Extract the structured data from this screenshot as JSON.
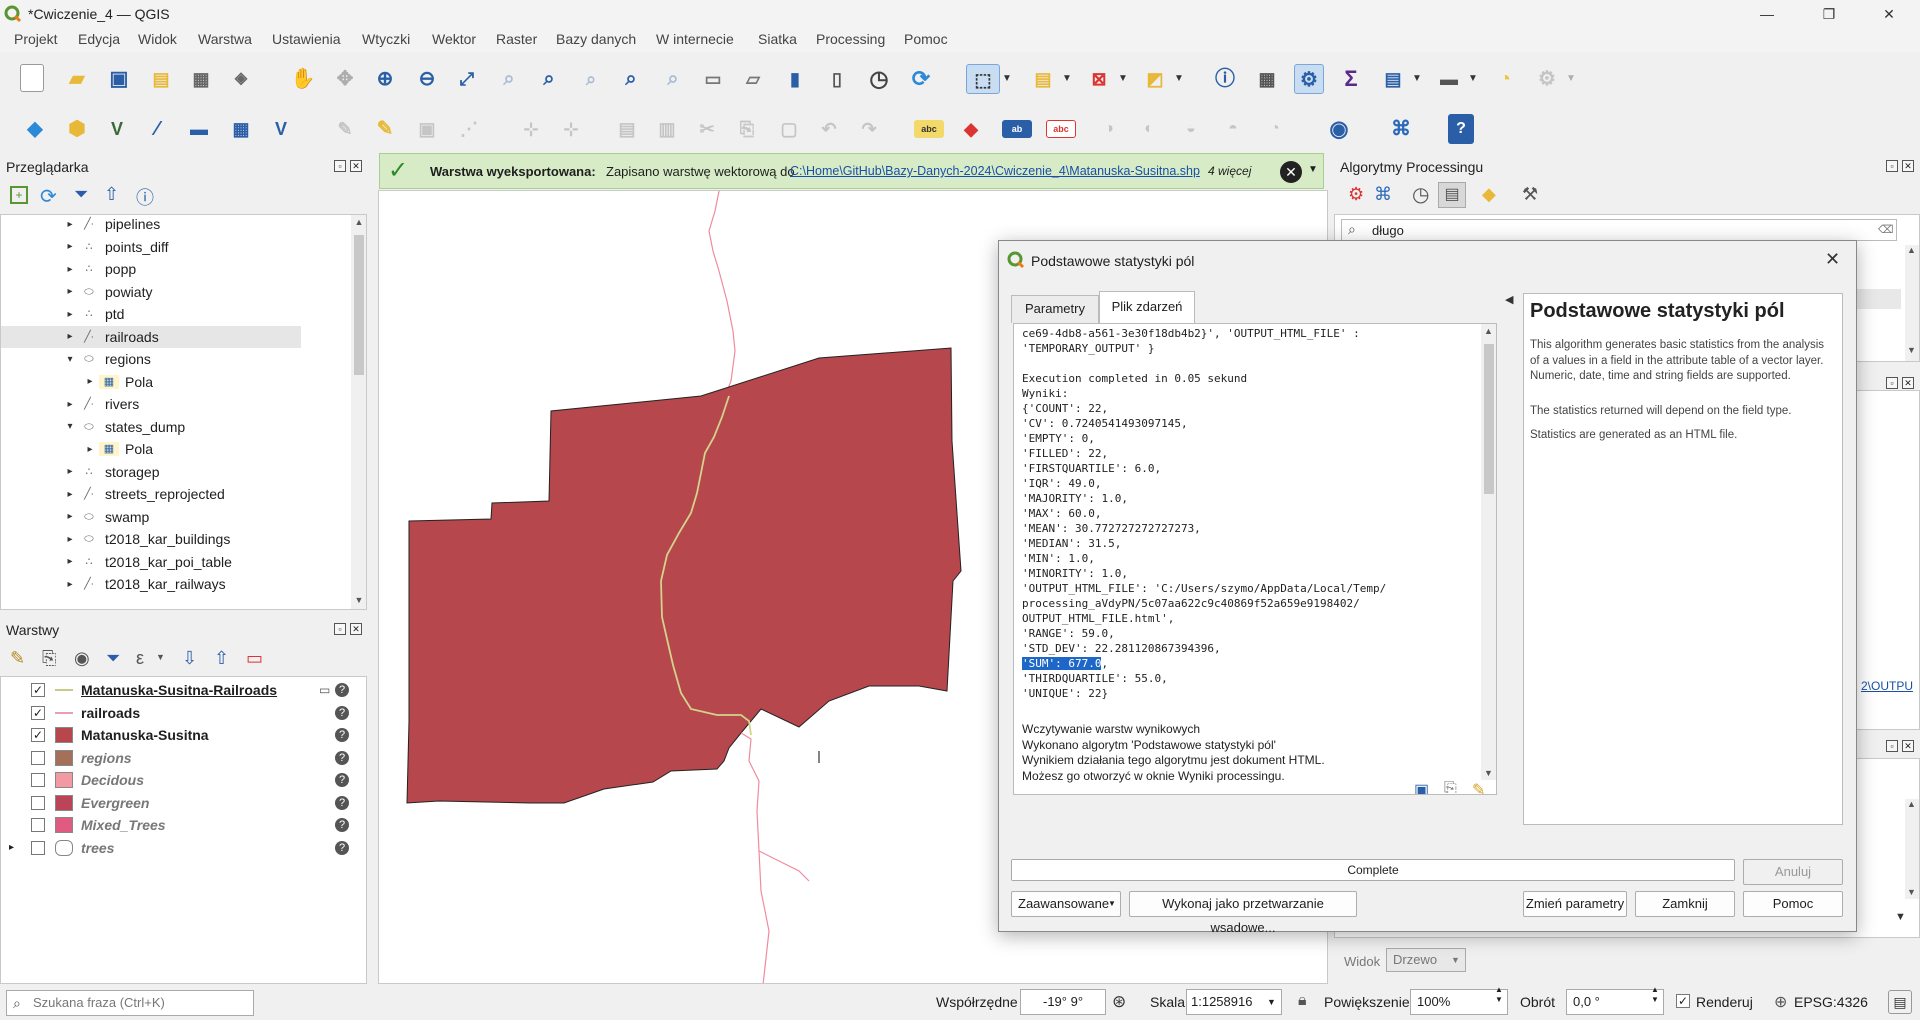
{
  "window": {
    "title": "*Cwiczenie_4 — QGIS"
  },
  "menu": [
    "Projekt",
    "Edycja",
    "Widok",
    "Warstwa",
    "Ustawienia",
    "Wtyczki",
    "Wektor",
    "Raster",
    "Bazy danych",
    "W internecie",
    "Siatka",
    "Processing",
    "Pomoc"
  ],
  "browser": {
    "title": "Przeglądarka",
    "items": [
      {
        "label": "pipelines",
        "type": "line",
        "indent": 0,
        "expanded": false
      },
      {
        "label": "points_diff",
        "type": "point",
        "indent": 0,
        "expanded": false
      },
      {
        "label": "popp",
        "type": "point",
        "indent": 0,
        "expanded": false
      },
      {
        "label": "powiaty",
        "type": "polygon",
        "indent": 0,
        "expanded": false
      },
      {
        "label": "ptd",
        "type": "point",
        "indent": 0,
        "expanded": false
      },
      {
        "label": "railroads",
        "type": "line",
        "indent": 0,
        "expanded": false,
        "selected": true
      },
      {
        "label": "regions",
        "type": "polygon",
        "indent": 0,
        "expanded": true
      },
      {
        "label": "Pola",
        "type": "table",
        "indent": 1,
        "expanded": false
      },
      {
        "label": "rivers",
        "type": "line",
        "indent": 0,
        "expanded": false
      },
      {
        "label": "states_dump",
        "type": "polygon",
        "indent": 0,
        "expanded": true
      },
      {
        "label": "Pola",
        "type": "table",
        "indent": 1,
        "expanded": false
      },
      {
        "label": "storagep",
        "type": "point",
        "indent": 0,
        "expanded": false
      },
      {
        "label": "streets_reprojected",
        "type": "line",
        "indent": 0,
        "expanded": false
      },
      {
        "label": "swamp",
        "type": "polygon",
        "indent": 0,
        "expanded": false
      },
      {
        "label": "t2018_kar_buildings",
        "type": "polygon",
        "indent": 0,
        "expanded": false
      },
      {
        "label": "t2018_kar_poi_table",
        "type": "point",
        "indent": 0,
        "expanded": false
      },
      {
        "label": "t2018_kar_railways",
        "type": "line",
        "indent": 0,
        "expanded": false
      }
    ]
  },
  "layers": {
    "title": "Warstwy",
    "items": [
      {
        "label": "Matanuska-Susitna-Railroads",
        "checked": true,
        "swatch": "line",
        "color": "#c9c98a",
        "style": "bold-underline"
      },
      {
        "label": "railroads",
        "checked": true,
        "swatch": "line",
        "color": "#e8a0b0",
        "style": "bold"
      },
      {
        "label": "Matanuska-Susitna",
        "checked": true,
        "swatch": "fill",
        "color": "#b5474d",
        "style": "bold"
      },
      {
        "label": "regions",
        "checked": false,
        "swatch": "fill",
        "color": "#a5705a",
        "style": "italic"
      },
      {
        "label": "Decidous",
        "checked": false,
        "swatch": "fill",
        "color": "#f29aa4",
        "style": "italic"
      },
      {
        "label": "Evergreen",
        "checked": false,
        "swatch": "fill",
        "color": "#bb4458",
        "style": "italic"
      },
      {
        "label": "Mixed_Trees",
        "checked": false,
        "swatch": "fill",
        "color": "#e05a82",
        "style": "italic"
      },
      {
        "label": "trees",
        "checked": false,
        "swatch": "group",
        "color": "#888888",
        "style": "italic"
      }
    ]
  },
  "message": {
    "bold": "Warstwa wyeksportowana:",
    "text": "Zapisano warstwę wektorową do",
    "link": "C:\\Home\\GitHub\\Bazy-Danych-2024\\Cwiczenie_4\\Matanuska-Susitna.shp",
    "more": "4 więcej"
  },
  "processing": {
    "title": "Algorytmy Processingu",
    "search": "długo",
    "side_text": "2\\OUTPU",
    "view_label": "Widok",
    "view_value": "Drzewo"
  },
  "dialog": {
    "title": "Podstawowe statystyki pól",
    "tabs": [
      "Parametry",
      "Plik zdarzeń"
    ],
    "log_lines": [
      "ce69-4db8-a561-3e30f18db4b2}', 'OUTPUT_HTML_FILE' :",
      "'TEMPORARY_OUTPUT' }",
      "",
      "Execution completed in 0.05 sekund",
      "Wyniki:",
      "{'COUNT': 22,",
      "'CV': 0.7240541493097145,",
      "'EMPTY': 0,",
      "'FILLED': 22,",
      "'FIRSTQUARTILE': 6.0,",
      "'IQR': 49.0,",
      "'MAJORITY': 1.0,",
      "'MAX': 60.0,",
      "'MEAN': 30.772727272727273,",
      "'MEDIAN': 31.5,",
      "'MIN': 1.0,",
      "'MINORITY': 1.0,",
      "'OUTPUT_HTML_FILE': 'C:/Users/szymo/AppData/Local/Temp/",
      "processing_aVdyPN/5c07aa622c9c40869f52a659e9198402/",
      "OUTPUT_HTML_FILE.html',",
      "'RANGE': 59.0,",
      "'STD_DEV': 22.281120867394396,"
    ],
    "log_selected": "'SUM': 677.0",
    "log_after_selected": ",",
    "log_lines2": [
      "'THIRDQUARTILE': 55.0,",
      "'UNIQUE': 22}"
    ],
    "log_tail": [
      "Wczytywanie warstw wynikowych",
      "Wykonano algorytm 'Podstawowe statystyki pól'",
      "Wynikiem działania tego algorytmu jest dokument HTML.",
      "Możesz go otworzyć w oknie Wyniki processingu."
    ],
    "help_title": "Podstawowe statystyki pól",
    "help_paragraphs": [
      "This algorithm generates basic statistics from the analysis of a values in a field in the attribute table of a vector layer. Numeric, date, time and string fields are supported.",
      "The statistics returned will depend on the field type.",
      "Statistics are generated as an HTML file."
    ],
    "progress_label": "Complete",
    "progress": 1.0,
    "buttons": {
      "cancel": "Anuluj",
      "advanced": "Zaawansowane",
      "batch": "Wykonaj jako przetwarzanie wsadowe...",
      "change": "Zmień parametry",
      "close": "Zamknij",
      "help": "Pomoc"
    }
  },
  "status": {
    "search_placeholder": "Szukana fraza (Ctrl+K)",
    "coords_label": "Współrzędne",
    "coords": "-19° 9°",
    "scale_label": "Skala",
    "scale": "1:1258916",
    "zoom_label": "Powiększenie",
    "zoom": "100%",
    "rotation_label": "Obrót",
    "rotation": "0,0 °",
    "render_label": "Renderuj",
    "crs": "EPSG:4326"
  },
  "colors": {
    "accent": "#589632",
    "polygon": "#b5474d",
    "river": "#f08aa0",
    "railroad": "#d3d38a",
    "selection": "#1e67c8"
  }
}
